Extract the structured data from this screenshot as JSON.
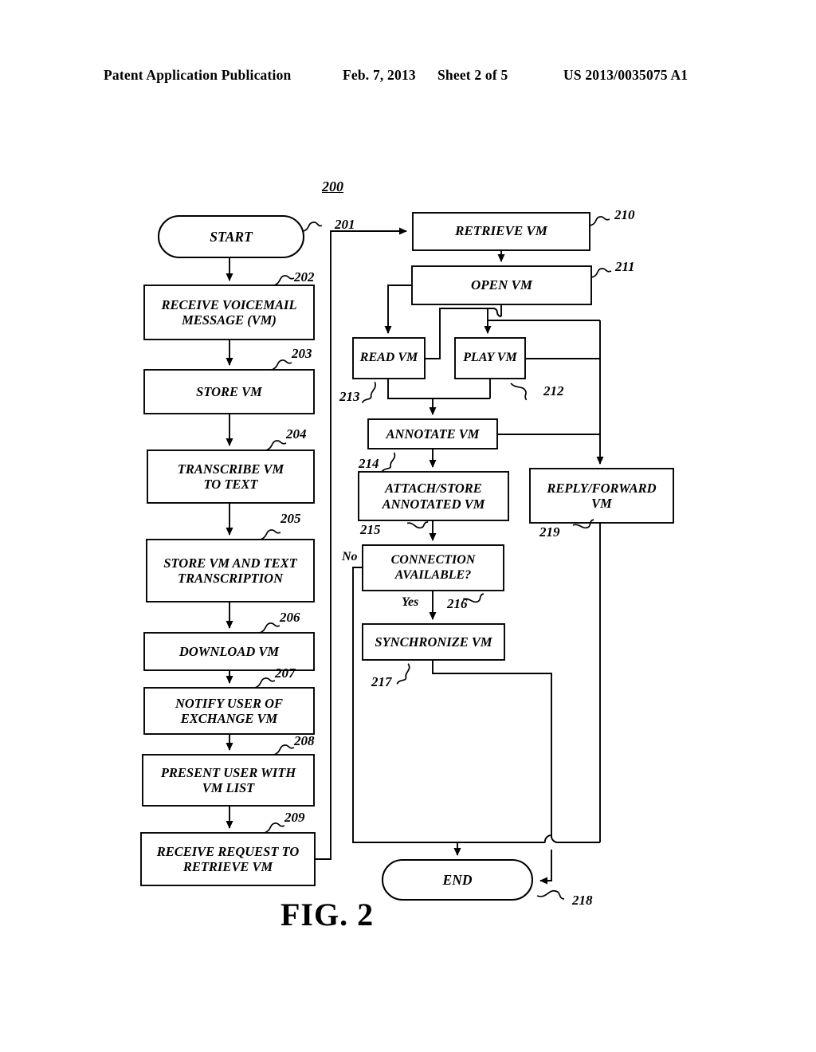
{
  "header": {
    "publication": "Patent Application Publication",
    "date": "Feb. 7, 2013",
    "sheet": "Sheet 2 of 5",
    "patent_number": "US 2013/0035075 A1"
  },
  "figure": {
    "caption": "FIG. 2",
    "diagram_number": "200"
  },
  "nodes": {
    "start": {
      "label": "START",
      "ref": ""
    },
    "receive_vm": {
      "label": "RECEIVE VOICEMAIL\nMESSAGE (VM)",
      "ref": "202"
    },
    "store_vm": {
      "label": "STORE VM",
      "ref": "203"
    },
    "transcribe": {
      "label": "TRANSCRIBE VM\nTO TEXT",
      "ref": "204"
    },
    "store_vm_text": {
      "label": "STORE VM AND TEXT\nTRANSCRIPTION",
      "ref": "205"
    },
    "download_vm": {
      "label": "DOWNLOAD VM",
      "ref": "206"
    },
    "notify_user": {
      "label": "NOTIFY USER OF\nEXCHANGE VM",
      "ref": "207"
    },
    "present_list": {
      "label": "PRESENT USER WITH\nVM LIST",
      "ref": "208"
    },
    "receive_request": {
      "label": "RECEIVE REQUEST TO\nRETRIEVE VM",
      "ref": "209"
    },
    "retrieve_vm": {
      "label": "RETRIEVE VM",
      "ref": "210"
    },
    "open_vm": {
      "label": "OPEN VM",
      "ref": "211"
    },
    "read_vm": {
      "label": "READ VM",
      "ref": "213"
    },
    "play_vm": {
      "label": "PLAY VM",
      "ref": "212"
    },
    "annotate_vm": {
      "label": "ANNOTATE VM",
      "ref": "214"
    },
    "attach_store": {
      "label": "ATTACH/STORE\nANNOTATED VM",
      "ref": "215"
    },
    "connection": {
      "label": "CONNECTION\nAVAILABLE?",
      "ref": "216"
    },
    "synchronize": {
      "label": "SYNCHRONIZE VM",
      "ref": "217"
    },
    "reply_forward": {
      "label": "REPLY/FORWARD\nVM",
      "ref": "219"
    },
    "end": {
      "label": "END",
      "ref": "218"
    }
  },
  "connectors": {
    "flow_201": "201",
    "decision_no": "No",
    "decision_yes": "Yes"
  },
  "colors": {
    "ink": "#000000",
    "paper": "#ffffff"
  }
}
